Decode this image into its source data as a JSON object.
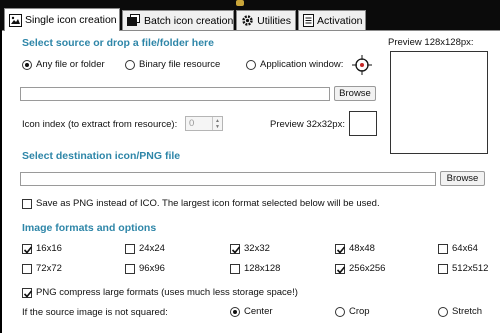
{
  "tabs": [
    {
      "label": "Single icon creation",
      "icon": "image-icon",
      "active": true
    },
    {
      "label": "Batch icon creation",
      "icon": "batch-icon",
      "active": false
    },
    {
      "label": "Utilities",
      "icon": "gear-icon",
      "active": false
    },
    {
      "label": "Activation",
      "icon": "document-icon",
      "active": false
    }
  ],
  "source": {
    "heading": "Select source or drop a file/folder here",
    "options": [
      {
        "label": "Any file or folder",
        "selected": true
      },
      {
        "label": "Binary file resource",
        "selected": false
      },
      {
        "label": "Application window:",
        "selected": false
      }
    ],
    "path_value": "",
    "browse_label": "Browse",
    "icon_index_label": "Icon index (to extract from resource):",
    "icon_index_value": "0",
    "preview_small_label": "Preview 32x32px:"
  },
  "preview_large_label": "Preview 128x128px:",
  "destination": {
    "heading": "Select destination icon/PNG file",
    "path_value": "",
    "browse_label": "Browse",
    "save_png_label": "Save as PNG instead of ICO. The largest icon format selected below will be used.",
    "save_png_checked": false
  },
  "formats": {
    "heading": "Image formats and options",
    "items": [
      {
        "label": "16x16",
        "checked": true
      },
      {
        "label": "24x24",
        "checked": false
      },
      {
        "label": "32x32",
        "checked": true
      },
      {
        "label": "48x48",
        "checked": true
      },
      {
        "label": "64x64",
        "checked": false
      },
      {
        "label": "72x72",
        "checked": false
      },
      {
        "label": "96x96",
        "checked": false
      },
      {
        "label": "128x128",
        "checked": false
      },
      {
        "label": "256x256",
        "checked": true
      },
      {
        "label": "512x512",
        "checked": false
      }
    ],
    "compress_label": "PNG compress large formats (uses much less storage space!)",
    "compress_checked": true,
    "not_squared_label": "If the source image is not squared:",
    "square_options": [
      {
        "label": "Center",
        "selected": true
      },
      {
        "label": "Crop",
        "selected": false
      },
      {
        "label": "Stretch",
        "selected": false
      }
    ]
  }
}
